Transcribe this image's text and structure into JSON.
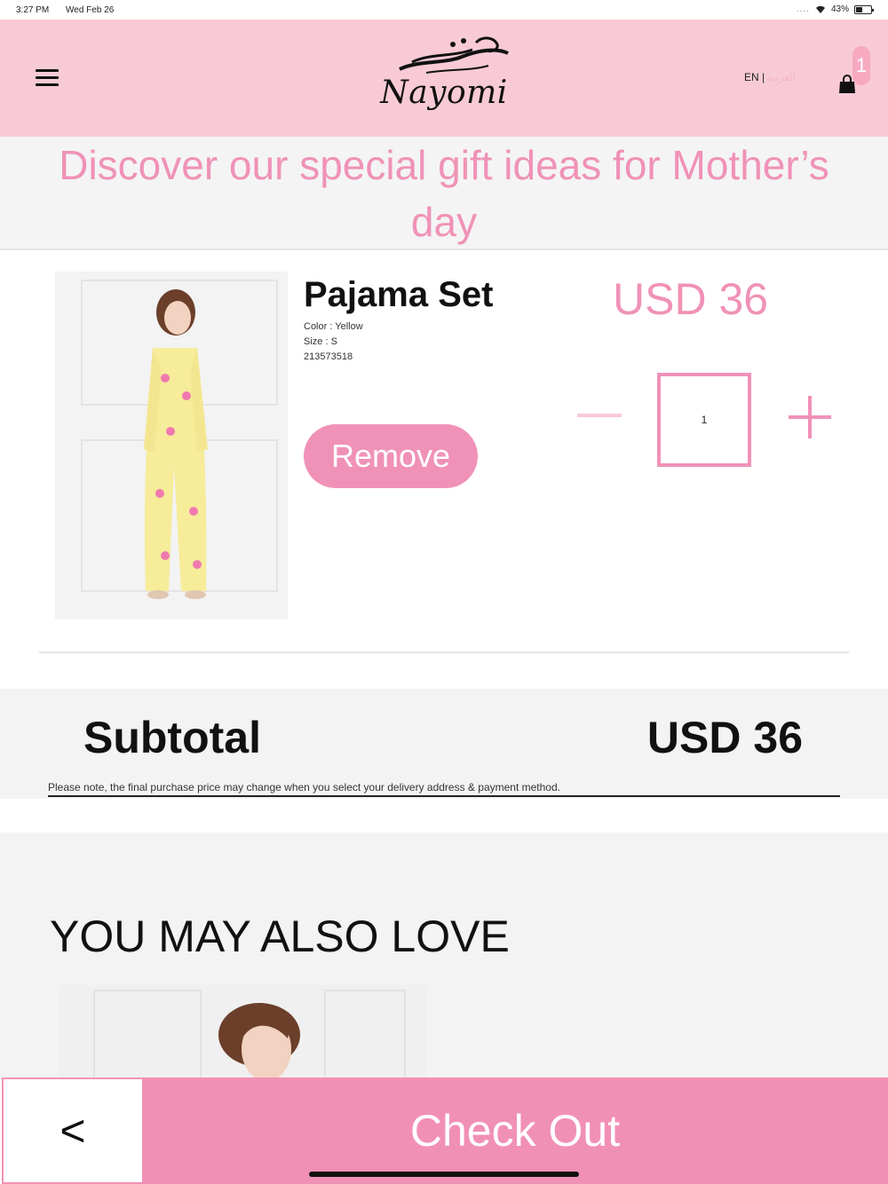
{
  "status_bar": {
    "time": "3:27 PM",
    "date": "Wed Feb 26",
    "signal_dots": "....",
    "battery": "43%"
  },
  "header": {
    "brand": "Nayomi",
    "lang_en": "EN |",
    "lang_ar": "العربية",
    "cart_count": "1"
  },
  "banner": {
    "line1": "Discover our special gift ideas for Mother’s",
    "line2": "day"
  },
  "cart_item": {
    "name": "Pajama Set",
    "color": "Color : Yellow",
    "size": "Size : S",
    "sku": "213573518",
    "price": "USD 36",
    "remove_label": "Remove",
    "quantity": "1"
  },
  "summary": {
    "subtotal_label": "Subtotal",
    "subtotal_value": "USD 36",
    "note": "Please note, the final purchase price may change when you select your delivery address & payment method."
  },
  "recommendations": {
    "title": "YOU MAY ALSO LOVE"
  },
  "footer": {
    "back_label": "<",
    "checkout_label": "Check Out"
  },
  "colors": {
    "header_bg": "#f8cad6",
    "accent_pink": "#f092b7",
    "checkout_bg": "#f190b5"
  },
  "icons": [
    "hamburger-menu-icon",
    "shopping-bag-icon",
    "wifi-icon",
    "battery-icon",
    "minus-icon",
    "plus-icon"
  ]
}
